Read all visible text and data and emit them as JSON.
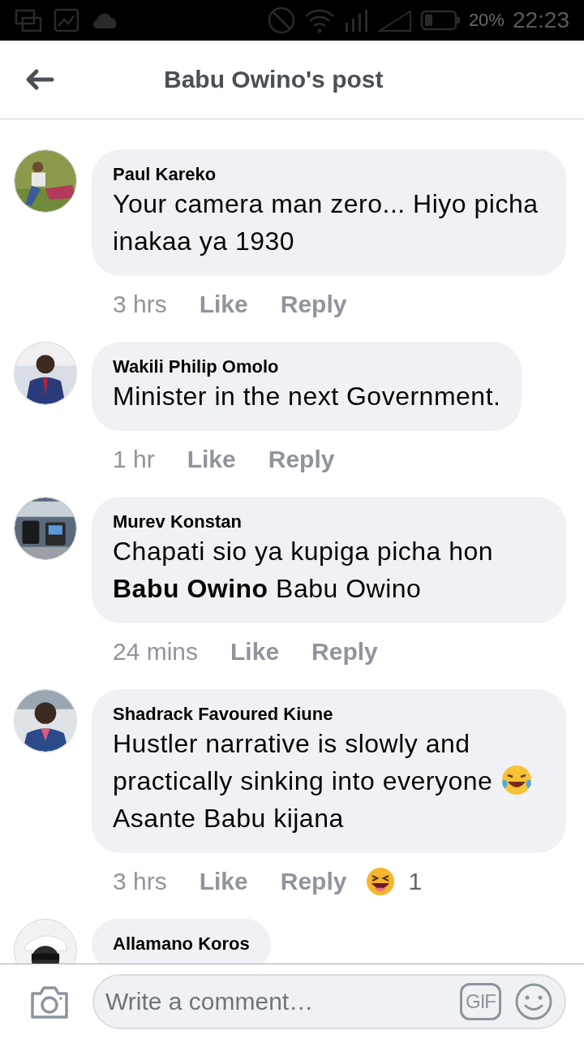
{
  "status_bar": {
    "battery": "20%",
    "time": "22:23"
  },
  "header": {
    "title": "Babu Owino's post"
  },
  "comments": [
    {
      "author": "Paul Kareko",
      "message": "Your camera man zero... Hiyo picha inakaa ya 1930",
      "time": "3 hrs",
      "like": "Like",
      "reply": "Reply"
    },
    {
      "author": "Wakili Philip Omolo",
      "message": "Minister in the next Government.",
      "time": "1 hr",
      "like": "Like",
      "reply": "Reply"
    },
    {
      "author": "Murev Konstan",
      "message": "Chapati sio ya kupiga picha hon **Babu Owino** Babu Owino",
      "time": "24 mins",
      "like": "Like",
      "reply": "Reply"
    },
    {
      "author": "Shadrack Favoured Kiune",
      "message": "Hustler narrative is slowly and practically sinking into everyone",
      "emoji": {
        "kind": "tears_of_joy"
      },
      "message_end": "Asante Babu kijana",
      "time": "3 hrs",
      "like": "Like",
      "reply": "Reply",
      "reaction": {
        "kind": "haha",
        "count": "1"
      }
    },
    {
      "author": "Allamano Koros"
    }
  ],
  "composer": {
    "placeholder": "Write a comment…",
    "gif": "GIF"
  }
}
